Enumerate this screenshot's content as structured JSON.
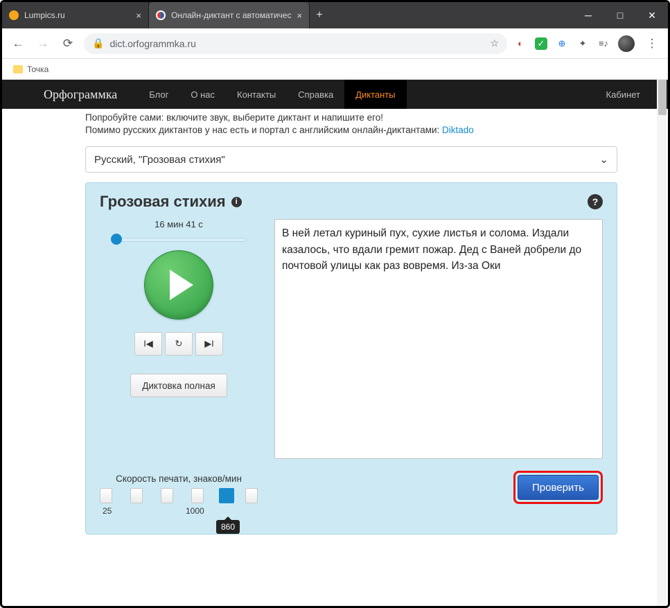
{
  "window": {
    "tabs": [
      {
        "title": "Lumpics.ru"
      },
      {
        "title": "Онлайн-диктант с автоматичес"
      }
    ],
    "url": "dict.orfogrammka.ru",
    "bookmark": "Точка"
  },
  "nav": {
    "brand": "Орфограммка",
    "links": [
      "Блог",
      "О нас",
      "Контакты",
      "Справка",
      "Диктанты"
    ],
    "cabinet": "Кабинет"
  },
  "intro": {
    "line1": "Попробуйте сами: включите звук, выберите диктант и напишите его!",
    "line2_a": "Помимо русских диктантов у нас есть и портал с английским онлайн-диктантами: ",
    "line2_link": "Diktado"
  },
  "select": {
    "value": "Русский, \"Грозовая стихия\""
  },
  "card": {
    "title": "Грозовая стихия",
    "duration": "16 мин 41 с",
    "mode": "Диктовка полная",
    "speed_label": "Скорость печати, знаков/мин",
    "speed_min": "25",
    "speed_max": "1000",
    "speed_value": "860",
    "text": "В ней летал куриный пух, сухие листья и солома. Издали казалось, что вдали гремит пожар. Дед с Ваней добрели до почтовой улицы как раз вовремя. Из-за Оки",
    "check": "Проверить"
  }
}
